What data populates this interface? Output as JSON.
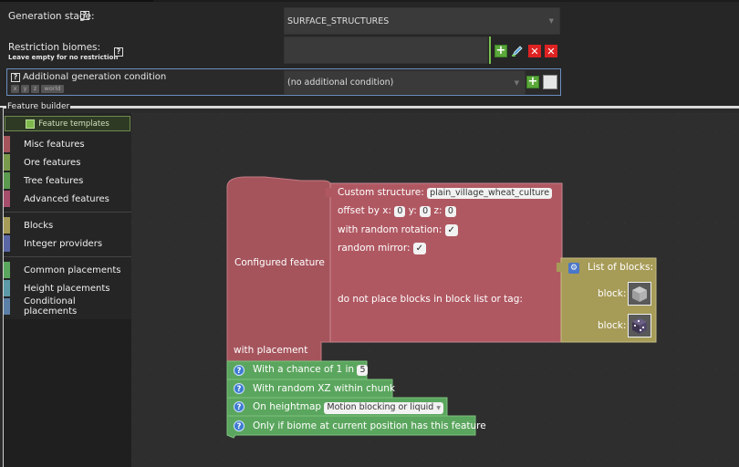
{
  "form": {
    "generation_stage_label": "Generation stage:",
    "generation_stage_value": "SURFACE_STRUCTURES",
    "restriction_biomes_label": "Restriction biomes:",
    "restriction_biomes_hint": "Leave empty for no restriction",
    "additional_condition_label": "Additional generation condition",
    "additional_condition_chips": [
      "x",
      "y",
      "z",
      "world"
    ],
    "additional_condition_value": "(no additional condition)",
    "help_glyph": "?"
  },
  "feature_builder": {
    "title": "Feature builder",
    "templates_button": "Feature templates",
    "categories": [
      {
        "label": "Misc features",
        "color": "#a5545c"
      },
      {
        "label": "Ore features",
        "color": "#7a9a4c"
      },
      {
        "label": "Tree features",
        "color": "#5b9a4f"
      },
      {
        "label": "Advanced features",
        "color": "#a54d6b"
      },
      {
        "label": "Blocks",
        "color": "#a69b57"
      },
      {
        "label": "Integer providers",
        "color": "#5b66a6"
      },
      {
        "label": "Common placements",
        "color": "#5ba65e"
      },
      {
        "label": "Height placements",
        "color": "#5b9aa6"
      },
      {
        "label": "Conditional placements",
        "color": "#5b7fa6"
      }
    ]
  },
  "workspace": {
    "configured_feature": "Configured feature",
    "with_placement": "with placement",
    "custom_structure": {
      "label": "Custom structure:",
      "value": "plain_village_wheat_culture",
      "offset_label": "offset by x:",
      "x": "0",
      "y_label": "y:",
      "y": "0",
      "z_label": "z:",
      "z": "0",
      "random_rotation": "with random rotation:",
      "random_mirror": "random mirror:",
      "check": "✓",
      "do_not_place": "do not place blocks in block list or tag:"
    },
    "list_of_blocks": {
      "label": "List of blocks:",
      "block_label": "block:"
    },
    "placements": [
      {
        "text": "With a chance of 1 in",
        "value": "5"
      },
      {
        "text": "With random XZ within chunk"
      },
      {
        "text": "On heightmap",
        "value": "Motion blocking or liquid"
      },
      {
        "text": "Only if biome at current position has this feature"
      }
    ]
  },
  "colors": {
    "feature_block": "#a5545c",
    "structure_block": "#b05862",
    "list_block": "#a69b57",
    "placement_block": "#5ba65e",
    "accent_border": "#6a8ec0"
  }
}
